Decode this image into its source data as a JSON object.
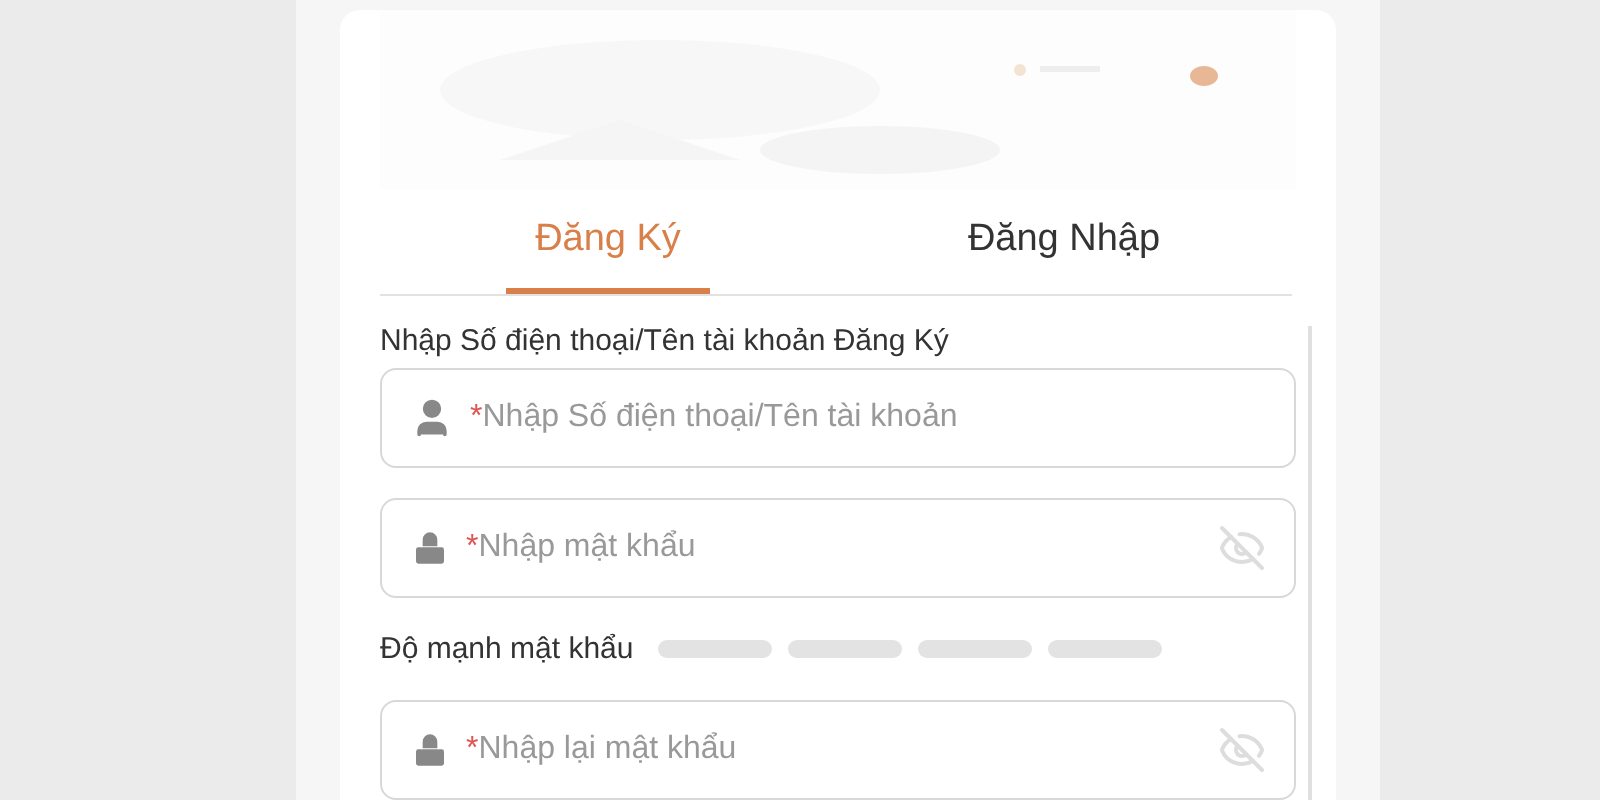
{
  "tabs": [
    {
      "label": "Đăng Ký",
      "selected": true
    },
    {
      "label": "Đăng Nhập",
      "selected": false
    }
  ],
  "section_label": "Nhập Số điện thoại/Tên tài khoản Đăng Ký",
  "fields": [
    {
      "kind": "account",
      "mark": "*",
      "placeholder": "Nhập Số điện thoại/Tên tài khoản"
    },
    {
      "kind": "password",
      "mark": "*",
      "placeholder": "Nhập mật khẩu",
      "visible": false
    },
    {
      "kind": "strength",
      "label": "Độ mạnh mật khẩu",
      "segments": [
        {
          "on": false
        },
        {
          "on": false
        },
        {
          "on": false
        },
        {
          "on": false
        }
      ]
    },
    {
      "kind": "password",
      "mark": "*",
      "placeholder": "Nhập lại mật khẩu",
      "visible": false
    }
  ]
}
